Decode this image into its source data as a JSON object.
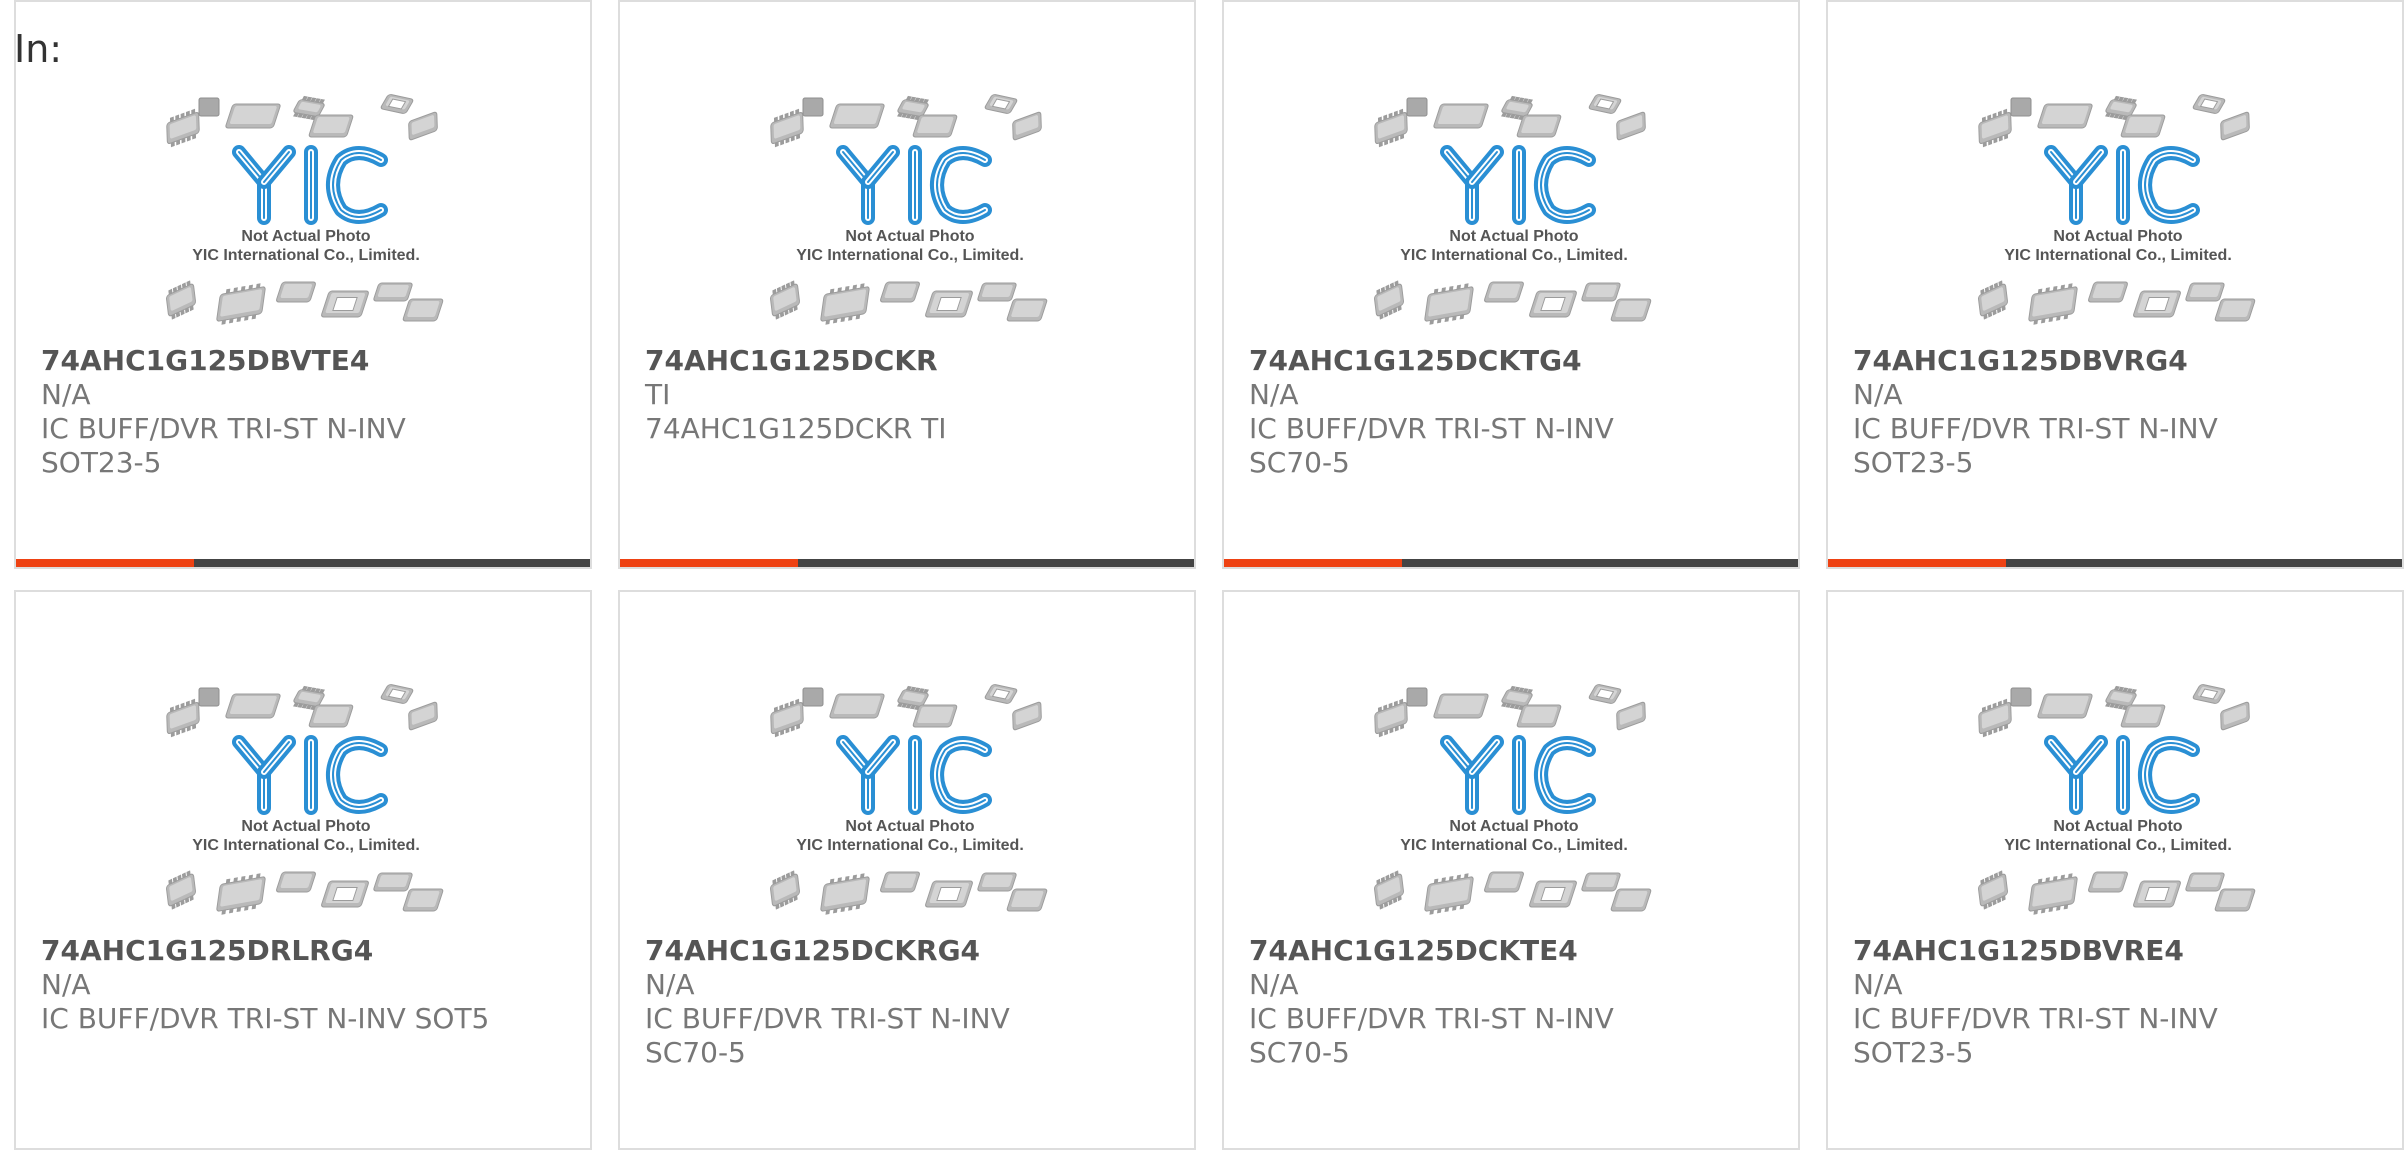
{
  "header": {
    "label": "In:"
  },
  "photo": {
    "caption_line1": "Not Actual Photo",
    "caption_line2": "YIC International Co., Limited.",
    "logo": "YIC"
  },
  "colors": {
    "accent": "#ee4213",
    "bar": "#444444",
    "logo_blue": "#2a8fd4"
  },
  "cards": [
    {
      "part": "74AHC1G125DBVTE4",
      "mfr": "N/A",
      "desc1": "IC BUFF/DVR TRI-ST N-INV",
      "desc2": "SOT23-5",
      "progress": 0.31
    },
    {
      "part": "74AHC1G125DCKR",
      "mfr": "TI",
      "desc1": "74AHC1G125DCKR TI",
      "desc2": "",
      "progress": 0.31
    },
    {
      "part": "74AHC1G125DCKTG4",
      "mfr": "N/A",
      "desc1": "IC BUFF/DVR TRI-ST N-INV",
      "desc2": "SC70-5",
      "progress": 0.31
    },
    {
      "part": "74AHC1G125DBVRG4",
      "mfr": "N/A",
      "desc1": "IC BUFF/DVR TRI-ST N-INV",
      "desc2": "SOT23-5",
      "progress": 0.31
    },
    {
      "part": "74AHC1G125DRLRG4",
      "mfr": "N/A",
      "desc1": "IC BUFF/DVR TRI-ST N-INV SOT5",
      "desc2": ""
    },
    {
      "part": "74AHC1G125DCKRG4",
      "mfr": "N/A",
      "desc1": "IC BUFF/DVR TRI-ST N-INV",
      "desc2": "SC70-5"
    },
    {
      "part": "74AHC1G125DCKTE4",
      "mfr": "N/A",
      "desc1": "IC BUFF/DVR TRI-ST N-INV",
      "desc2": "SC70-5"
    },
    {
      "part": "74AHC1G125DBVRE4",
      "mfr": "N/A",
      "desc1": "IC BUFF/DVR TRI-ST N-INV",
      "desc2": "SOT23-5"
    }
  ]
}
